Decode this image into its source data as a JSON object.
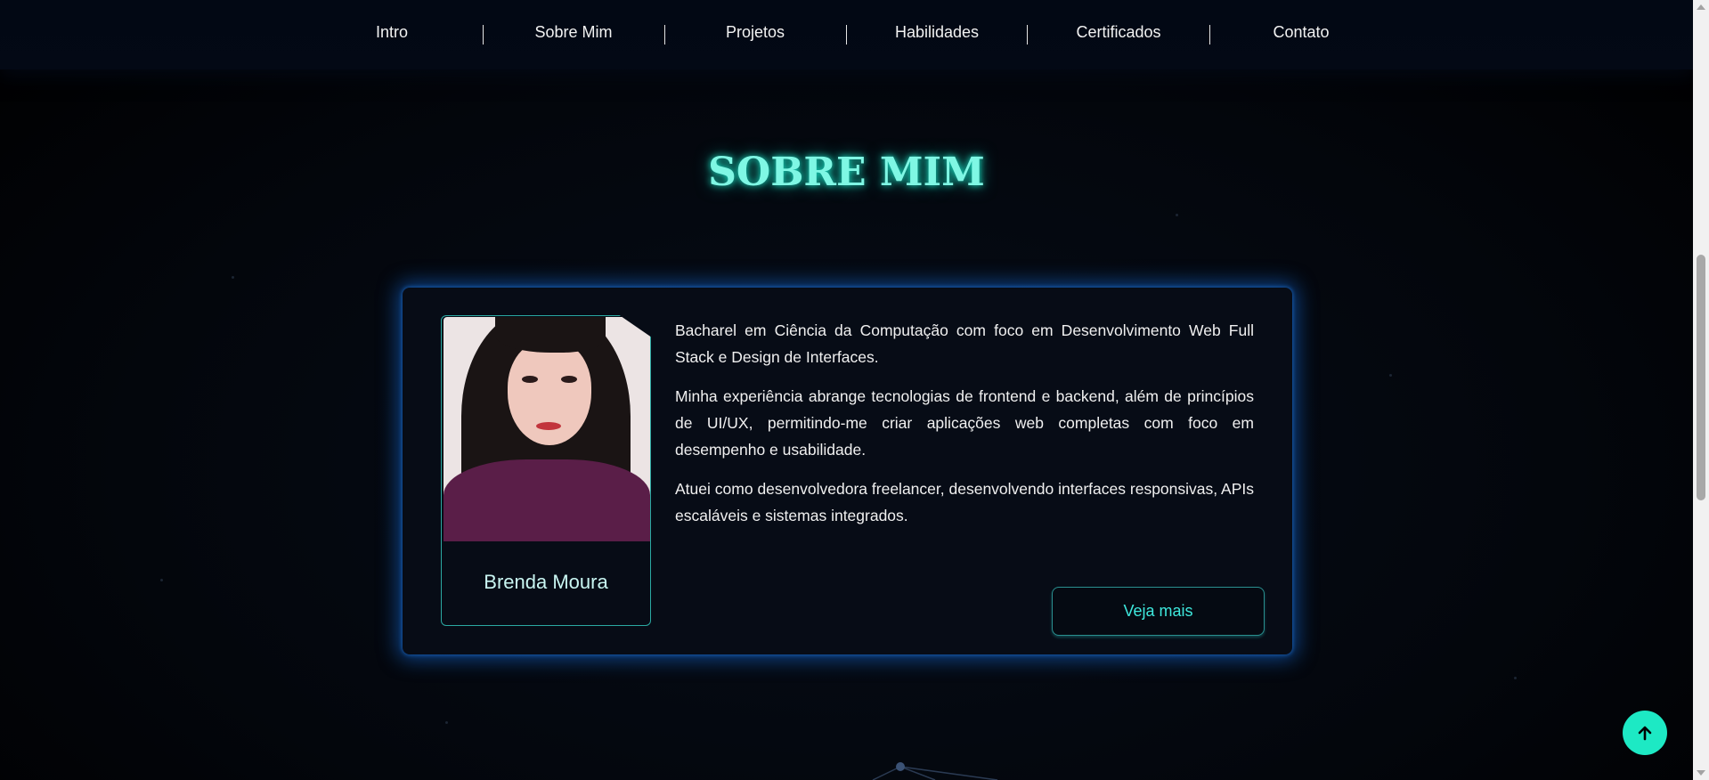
{
  "nav": {
    "items": [
      "Intro",
      "Sobre Mim",
      "Projetos",
      "Habilidades",
      "Certificados",
      "Contato"
    ]
  },
  "section": {
    "title": "SOBRE MIM"
  },
  "profile": {
    "name": "Brenda Moura"
  },
  "bio": {
    "paragraphs": [
      "Bacharel em Ciência da Computação com foco em Desenvolvimento Web Full Stack e Design de Interfaces.",
      "Minha experiência abrange tecnologias de frontend e backend, além de princípios de UI/UX, permitindo-me criar aplicações web completas com foco em desempenho e usabilidade.",
      "Atuei como desenvolvedora freelancer, desenvolvendo interfaces responsivas, APIs escaláveis e sistemas integrados."
    ]
  },
  "actions": {
    "more_label": "Veja mais"
  },
  "colors": {
    "accent": "#1de9c4",
    "title": "#7ff7e4",
    "card_glow": "#1e6edc"
  }
}
